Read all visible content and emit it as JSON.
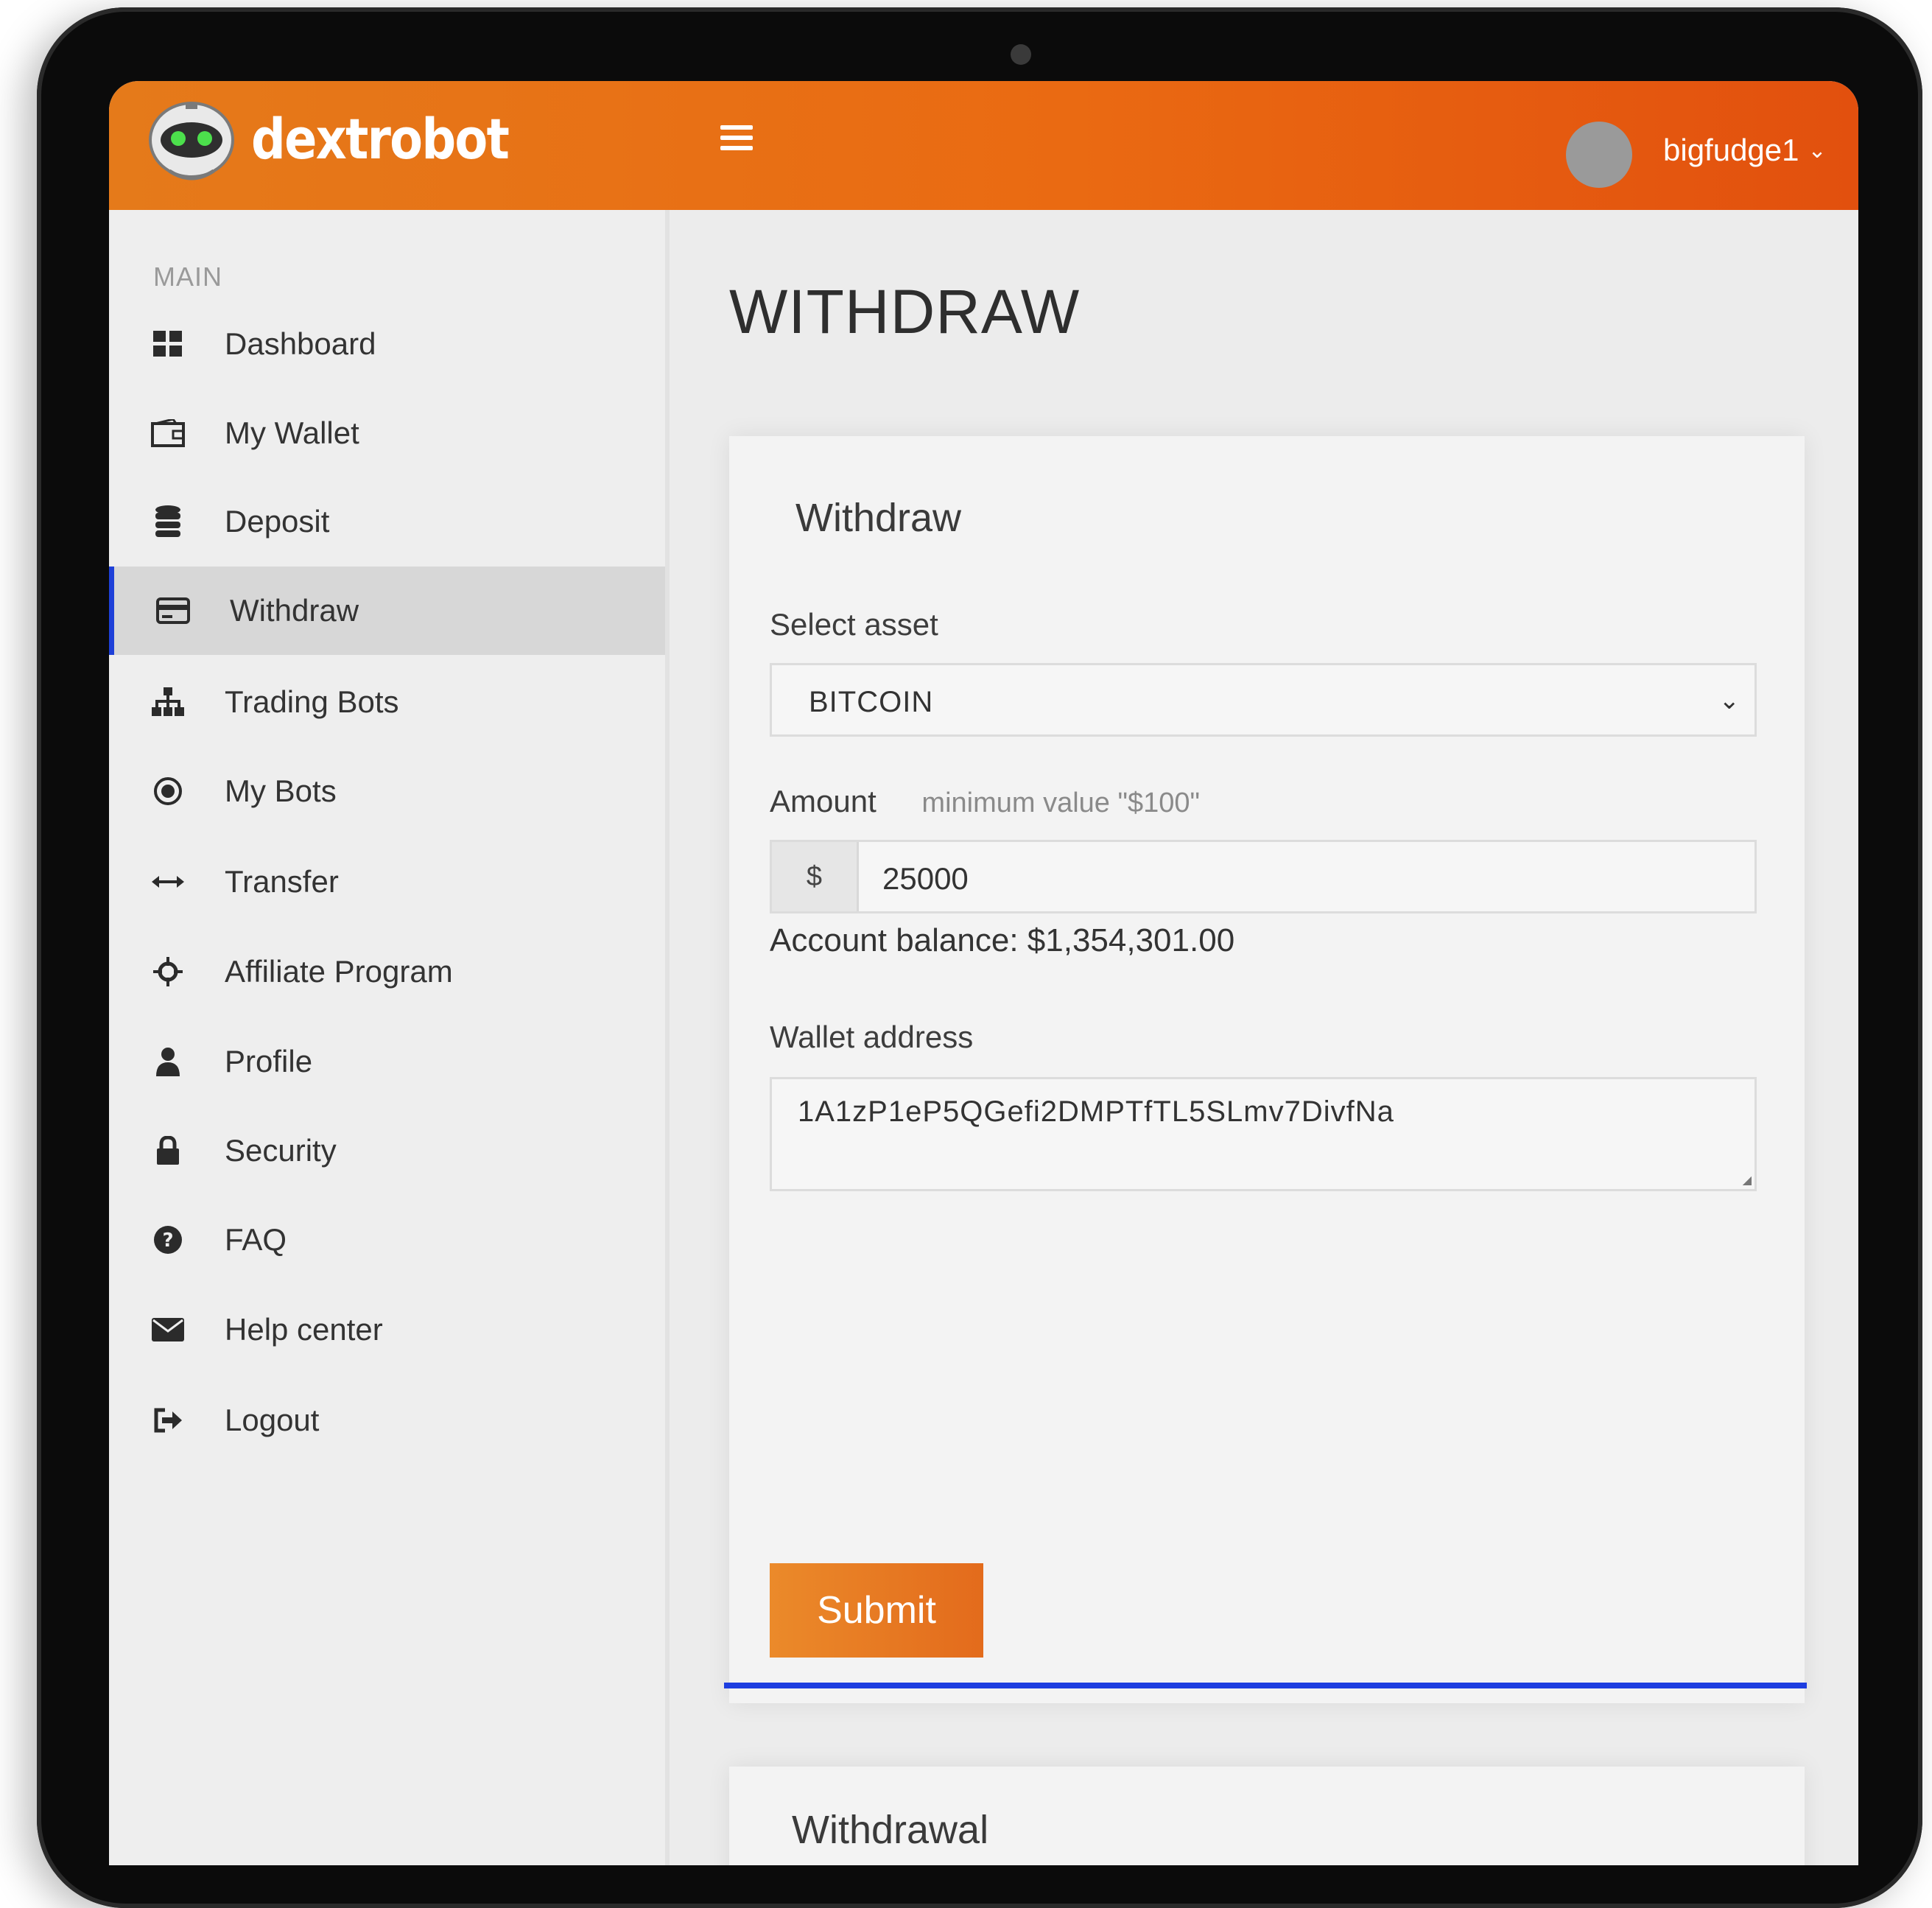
{
  "app": {
    "brand": "dextrobot",
    "username": "bigfudge1",
    "accent_color": "#e8661a",
    "active_indicator_color": "#1e40d8"
  },
  "sidebar": {
    "section_label": "MAIN",
    "items": [
      {
        "label": "Dashboard",
        "icon": "dashboard-icon"
      },
      {
        "label": "My Wallet",
        "icon": "wallet-icon"
      },
      {
        "label": "Deposit",
        "icon": "database-icon"
      },
      {
        "label": "Withdraw",
        "icon": "credit-card-icon",
        "active": true
      },
      {
        "label": "Trading Bots",
        "icon": "sitemap-icon"
      },
      {
        "label": "My Bots",
        "icon": "dot-circle-icon"
      },
      {
        "label": "Transfer",
        "icon": "arrows-horizontal-icon"
      },
      {
        "label": "Affiliate Program",
        "icon": "crosshair-icon"
      },
      {
        "label": "Profile",
        "icon": "user-icon"
      },
      {
        "label": "Security",
        "icon": "lock-icon"
      },
      {
        "label": "FAQ",
        "icon": "question-circle-icon"
      },
      {
        "label": "Help center",
        "icon": "envelope-icon"
      },
      {
        "label": "Logout",
        "icon": "sign-out-icon"
      }
    ]
  },
  "main": {
    "page_title": "WITHDRAW",
    "form": {
      "title": "Withdraw",
      "asset_label": "Select asset",
      "asset_value": "BITCOIN",
      "amount_label": "Amount",
      "amount_hint": "minimum value \"$100\"",
      "currency_symbol": "$",
      "amount_value": "25000",
      "balance_text": "Account balance: $1,354,301.00",
      "wallet_label": "Wallet address",
      "wallet_value": "1A1zP1eP5QGefi2DMPTfTL5SLmv7DivfNa",
      "submit_label": "Submit"
    },
    "history_title": "Withdrawal"
  }
}
